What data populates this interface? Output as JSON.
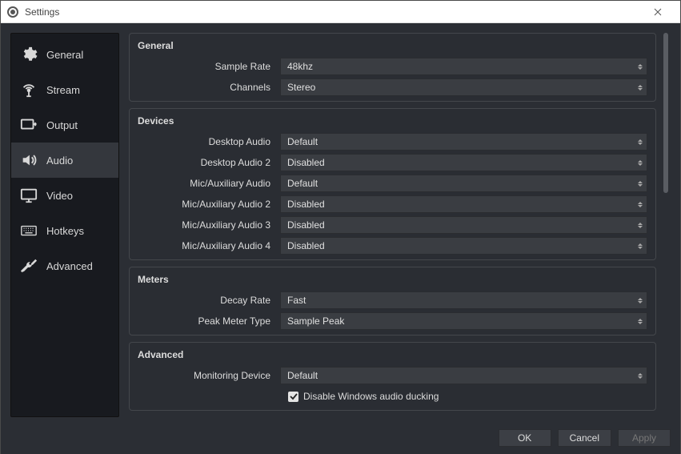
{
  "window": {
    "title": "Settings"
  },
  "sidebar": {
    "items": [
      {
        "label": "General"
      },
      {
        "label": "Stream"
      },
      {
        "label": "Output"
      },
      {
        "label": "Audio"
      },
      {
        "label": "Video"
      },
      {
        "label": "Hotkeys"
      },
      {
        "label": "Advanced"
      }
    ]
  },
  "groups": {
    "general": {
      "title": "General",
      "sample_rate": {
        "label": "Sample Rate",
        "value": "48khz"
      },
      "channels": {
        "label": "Channels",
        "value": "Stereo"
      }
    },
    "devices": {
      "title": "Devices",
      "desktop_audio": {
        "label": "Desktop Audio",
        "value": "Default"
      },
      "desktop_audio_2": {
        "label": "Desktop Audio 2",
        "value": "Disabled"
      },
      "mic_aux": {
        "label": "Mic/Auxiliary Audio",
        "value": "Default"
      },
      "mic_aux_2": {
        "label": "Mic/Auxiliary Audio 2",
        "value": "Disabled"
      },
      "mic_aux_3": {
        "label": "Mic/Auxiliary Audio 3",
        "value": "Disabled"
      },
      "mic_aux_4": {
        "label": "Mic/Auxiliary Audio 4",
        "value": "Disabled"
      }
    },
    "meters": {
      "title": "Meters",
      "decay_rate": {
        "label": "Decay Rate",
        "value": "Fast"
      },
      "peak_meter_type": {
        "label": "Peak Meter Type",
        "value": "Sample Peak"
      }
    },
    "advanced": {
      "title": "Advanced",
      "monitoring_device": {
        "label": "Monitoring Device",
        "value": "Default"
      },
      "disable_ducking": {
        "label": "Disable Windows audio ducking",
        "checked": true
      }
    }
  },
  "footer": {
    "ok": "OK",
    "cancel": "Cancel",
    "apply": "Apply"
  }
}
